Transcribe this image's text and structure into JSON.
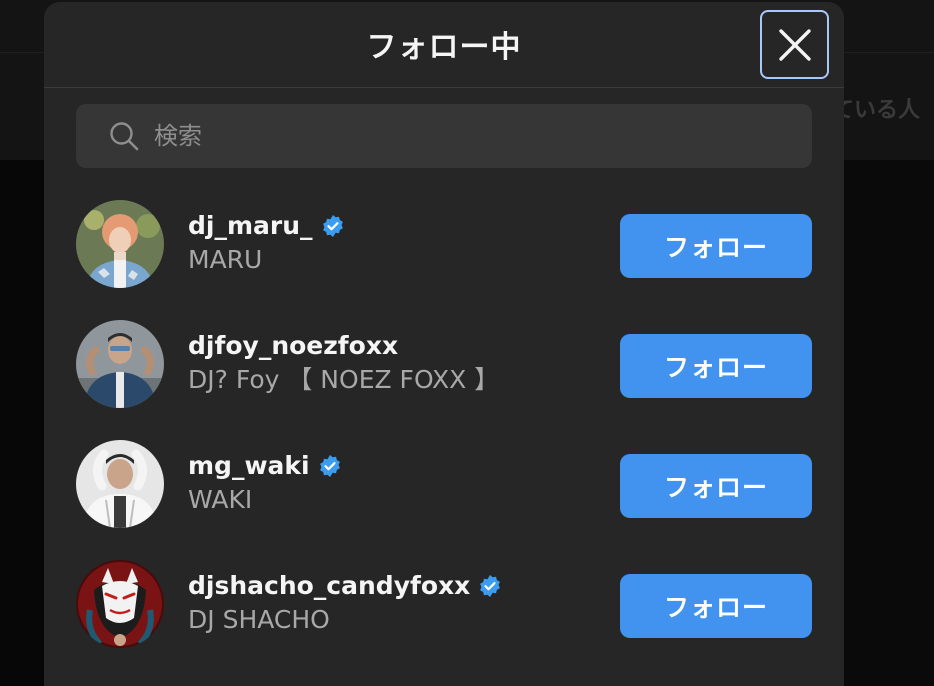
{
  "backdrop": {
    "partial_text": "ている人"
  },
  "modal": {
    "title": "フォロー中",
    "close_icon": "close-icon",
    "search": {
      "placeholder": "検索",
      "value": "",
      "icon": "search-icon"
    }
  },
  "users": [
    {
      "username": "dj_maru_",
      "fullname": "MARU",
      "verified": true,
      "button": "フォロー",
      "avatar_color": "#c98a6a"
    },
    {
      "username": "djfoy_noezfoxx",
      "fullname": "DJ? Foy 【 NOEZ FOXX 】",
      "verified": false,
      "button": "フォロー",
      "avatar_color": "#4a5056"
    },
    {
      "username": "mg_waki",
      "fullname": "WAKI",
      "verified": true,
      "button": "フォロー",
      "avatar_color": "#d8d8d8"
    },
    {
      "username": "djshacho_candyfoxx",
      "fullname": "DJ SHACHO",
      "verified": true,
      "button": "フォロー",
      "avatar_color": "#7a1414"
    }
  ],
  "colors": {
    "accent": "#4193ef",
    "verified": "#3b9cf0",
    "focus_ring": "#a8c7fa"
  }
}
